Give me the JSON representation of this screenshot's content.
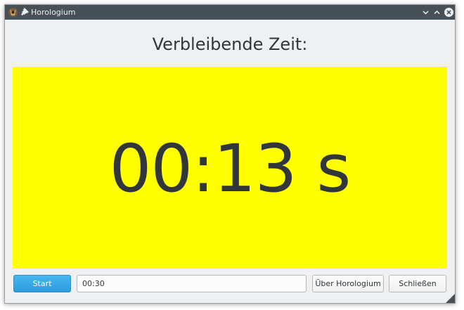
{
  "window": {
    "title": "Horologium",
    "app_icon": "horologium-app-icon",
    "pin_icon": "pin-icon",
    "controls": [
      "chevron-down-icon",
      "chevron-up-icon",
      "close-icon"
    ]
  },
  "main": {
    "heading": "Verbleibende Zeit:",
    "time_display": "00:13 s",
    "display_color": "#ffff00"
  },
  "controls": {
    "start_label": "Start",
    "time_input_value": "00:30",
    "about_label": "Über Horologium",
    "close_label": "Schließen"
  },
  "colors": {
    "titlebar": "#475057",
    "window_bg": "#eff0f1",
    "accent": "#2b9be0",
    "text": "#31363b"
  }
}
